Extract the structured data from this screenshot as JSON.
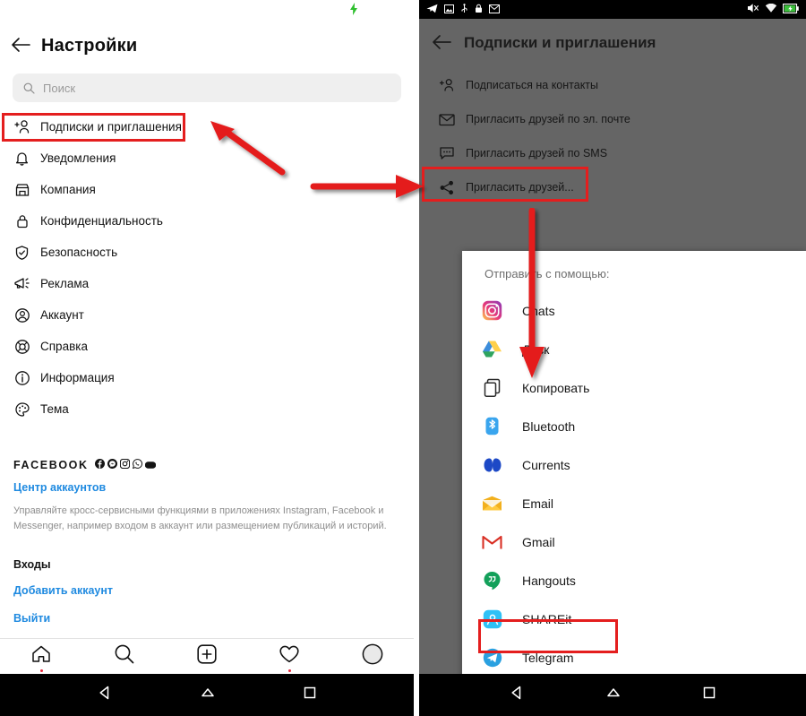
{
  "left_phone": {
    "status_bar": {
      "charging_icon": "lightning-bolt-icon"
    },
    "header": {
      "back_icon": "back-arrow-icon",
      "title": "Настройки"
    },
    "search": {
      "icon": "search-icon",
      "placeholder": "Поиск",
      "value": ""
    },
    "menu_items": [
      {
        "icon": "add-person-icon",
        "label": "Подписки и приглашения",
        "highlighted": true
      },
      {
        "icon": "bell-icon",
        "label": "Уведомления"
      },
      {
        "icon": "store-icon",
        "label": "Компания"
      },
      {
        "icon": "lock-icon",
        "label": "Конфиденциальность"
      },
      {
        "icon": "shield-check-icon",
        "label": "Безопасность"
      },
      {
        "icon": "megaphone-icon",
        "label": "Реклама"
      },
      {
        "icon": "account-circle-icon",
        "label": "Аккаунт"
      },
      {
        "icon": "lifebuoy-icon",
        "label": "Справка"
      },
      {
        "icon": "info-circle-icon",
        "label": "Информация"
      },
      {
        "icon": "palette-icon",
        "label": "Тема"
      }
    ],
    "facebook_section": {
      "word": "FACEBOOK",
      "brand_icons": [
        "facebook-icon",
        "messenger-icon",
        "instagram-icon",
        "whatsapp-icon",
        "oculus-icon"
      ],
      "accounts_center_link": "Центр аккаунтов",
      "description": "Управляйте кросс-сервисными функциями в приложениях Instagram, Facebook и Messenger, например входом в аккаунт или размещением публикаций и историй.",
      "logins_heading": "Входы",
      "add_account_link": "Добавить аккаунт",
      "logout_link": "Выйти"
    },
    "tab_bar": [
      {
        "icon": "home-icon",
        "badge": true
      },
      {
        "icon": "search-icon",
        "badge": false
      },
      {
        "icon": "add-post-icon",
        "badge": false
      },
      {
        "icon": "heart-icon",
        "badge": true
      },
      {
        "icon": "profile-avatar-icon",
        "badge": false
      }
    ],
    "nav_bar": [
      {
        "icon": "android-back-icon"
      },
      {
        "icon": "android-home-icon"
      },
      {
        "icon": "android-recents-icon"
      }
    ]
  },
  "right_phone": {
    "status_bar": {
      "left_icons": [
        "telegram-icon",
        "screenshot-icon",
        "usb-icon",
        "lock-icon",
        "mail-icon"
      ],
      "right_icons": [
        "mute-icon",
        "wifi-icon",
        "battery-charging-icon"
      ]
    },
    "header": {
      "back_icon": "back-arrow-icon",
      "title": "Подписки и приглашения"
    },
    "menu_items": [
      {
        "icon": "add-person-icon",
        "label": "Подписаться на контакты"
      },
      {
        "icon": "envelope-icon",
        "label": "Пригласить друзей по эл. почте"
      },
      {
        "icon": "sms-bubble-icon",
        "label": "Пригласить друзей по SMS"
      },
      {
        "icon": "share-nodes-icon",
        "label": "Пригласить друзей...",
        "highlighted": true
      }
    ],
    "share_dialog": {
      "title": "Отправить с помощью:",
      "items": [
        {
          "icon": "instagram-icon",
          "label": "Chats"
        },
        {
          "icon": "google-drive-icon",
          "label": "Диск"
        },
        {
          "icon": "copy-icon",
          "label": "Копировать",
          "highlighted": true
        },
        {
          "icon": "bluetooth-icon",
          "label": "Bluetooth"
        },
        {
          "icon": "currents-icon",
          "label": "Currents"
        },
        {
          "icon": "email-icon",
          "label": "Email"
        },
        {
          "icon": "gmail-icon",
          "label": "Gmail"
        },
        {
          "icon": "hangouts-icon",
          "label": "Hangouts"
        },
        {
          "icon": "shareit-icon",
          "label": "SHAREit"
        },
        {
          "icon": "telegram-icon",
          "label": "Telegram"
        }
      ]
    },
    "nav_bar": [
      {
        "icon": "android-back-icon"
      },
      {
        "icon": "android-home-icon"
      },
      {
        "icon": "android-recents-icon"
      }
    ]
  },
  "annotations": {
    "highlight_color": "#e41e1e",
    "arrows": [
      {
        "name": "arrow-to-subscriptions-item",
        "direction": "up-left"
      },
      {
        "name": "arrow-to-invite-friends-item",
        "direction": "right"
      },
      {
        "name": "arrow-to-copy-item",
        "direction": "down"
      }
    ]
  },
  "colors": {
    "accent_red": "#e41e1e",
    "link_blue": "#1f8ae0",
    "dim_background": "#656565",
    "search_field": "#efefef"
  }
}
